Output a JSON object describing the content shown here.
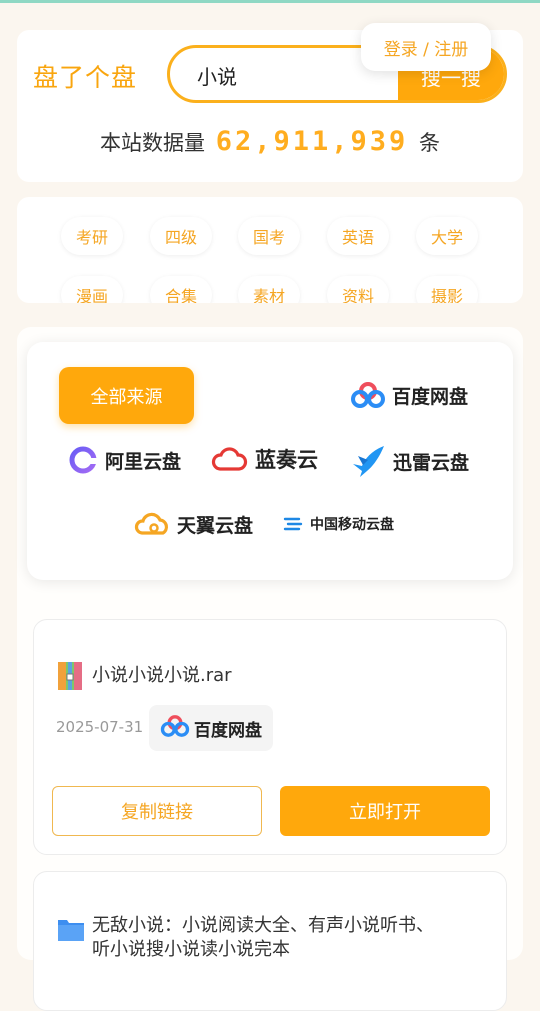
{
  "header": {
    "brand": "盘了个盘",
    "search": {
      "value": "小说",
      "button_label": "搜一搜"
    },
    "login_label": "登录 / 注册",
    "stats": {
      "prefix": "本站数据量",
      "count": "62,911,939",
      "suffix": "条"
    }
  },
  "tags": [
    "考研",
    "四级",
    "国考",
    "英语",
    "大学",
    "漫画",
    "合集",
    "素材",
    "资料",
    "摄影"
  ],
  "sources": {
    "all_label": "全部来源",
    "items": [
      {
        "label": "百度网盘",
        "icon": "baidu-netdisk-icon"
      },
      {
        "label": "阿里云盘",
        "icon": "aliyun-drive-icon"
      },
      {
        "label": "蓝奏云",
        "icon": "lanzou-cloud-icon"
      },
      {
        "label": "迅雷云盘",
        "icon": "xunlei-cloud-icon"
      },
      {
        "label": "天翼云盘",
        "icon": "tianyi-cloud-icon"
      },
      {
        "label": "中国移动云盘",
        "icon": "china-mobile-cloud-icon"
      }
    ]
  },
  "results": [
    {
      "title": "小说小说小说.rar",
      "file_icon": "archive-file-icon",
      "date": "2025-07-31",
      "source": "百度网盘",
      "copy_label": "复制链接",
      "open_label": "立即打开"
    },
    {
      "title_line1": "无敌小说：小说阅读大全、有声小说听书、",
      "title_line2": "听小说搜小说读小说完本",
      "file_icon": "folder-icon"
    }
  ],
  "colors": {
    "accent": "#ffa80c",
    "accent_text": "#f5a623",
    "background": "#fbf6ef",
    "top_bar": "#8fd8c4"
  }
}
